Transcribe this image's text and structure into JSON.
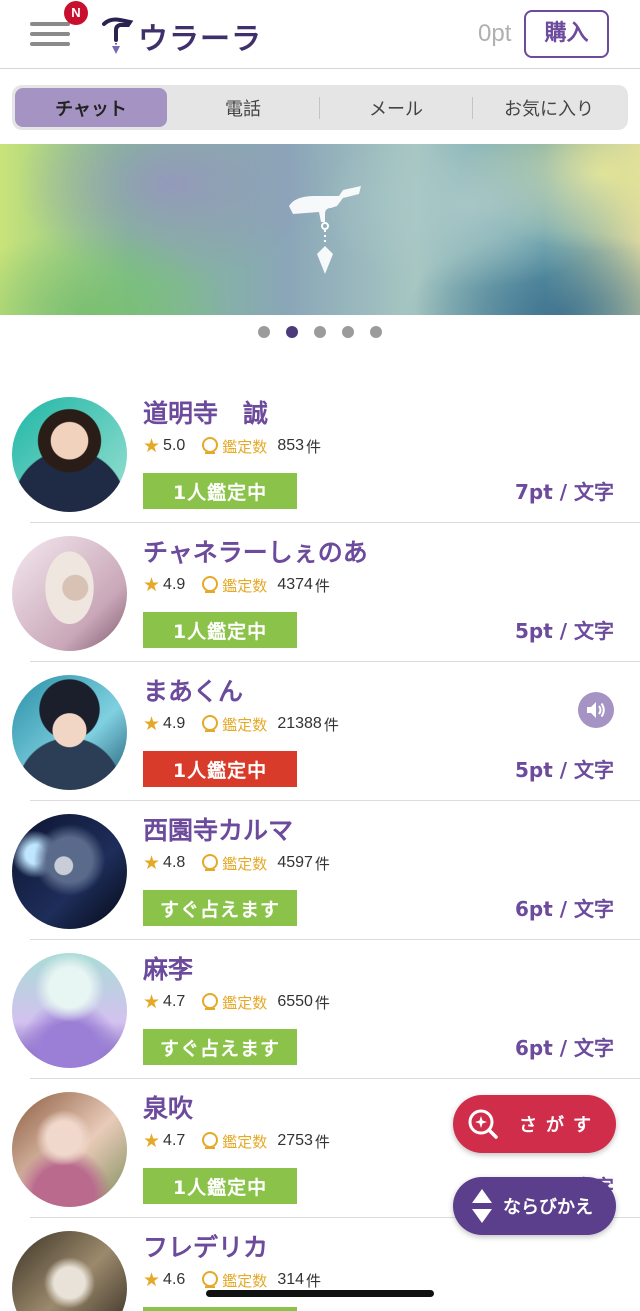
{
  "header": {
    "badge": "N",
    "logo_text": "ウラーラ",
    "points": "0pt",
    "buy_label": "購入"
  },
  "tabs": [
    {
      "label": "チャット",
      "active": true
    },
    {
      "label": "電話",
      "active": false
    },
    {
      "label": "メール",
      "active": false
    },
    {
      "label": "お気に入り",
      "active": false
    }
  ],
  "banner": {
    "slide_count": 5,
    "active_slide": 2
  },
  "count_label": "鑑定数",
  "count_unit": "件",
  "readers": [
    {
      "name": "道明寺　誠",
      "rating": "5.0",
      "count": "853",
      "status": "1人鑑定中",
      "status_color": "#8bc34a",
      "price": "7pt / 文字"
    },
    {
      "name": "チャネラーしぇのあ",
      "rating": "4.9",
      "count": "4374",
      "status": "1人鑑定中",
      "status_color": "#8bc34a",
      "price": "5pt / 文字"
    },
    {
      "name": "まあくん",
      "rating": "4.9",
      "count": "21388",
      "status": "1人鑑定中",
      "status_color": "#d93b2a",
      "price": "5pt / 文字"
    },
    {
      "name": "西園寺カルマ",
      "rating": "4.8",
      "count": "4597",
      "status": "すぐ占えます",
      "status_color": "#8bc34a",
      "price": "6pt / 文字"
    },
    {
      "name": "麻李",
      "rating": "4.7",
      "count": "6550",
      "status": "すぐ占えます",
      "status_color": "#8bc34a",
      "price": "6pt / 文字"
    },
    {
      "name": "泉吹",
      "rating": "4.7",
      "count": "2753",
      "status": "1人鑑定中",
      "status_color": "#8bc34a",
      "price": "5pt / 文字"
    },
    {
      "name": "フレデリカ",
      "rating": "4.6",
      "count": "314",
      "status": "",
      "status_color": "#8bc34a",
      "price": ""
    }
  ],
  "fab": {
    "search_label": "さがす",
    "sort_label": "ならびかえ"
  },
  "colors": {
    "brand_purple": "#6c4a9c",
    "tab_active": "#a593c4",
    "status_green": "#8bc34a",
    "status_red": "#d93b2a",
    "star": "#e5a928",
    "search_fab": "#cf2d4a",
    "sort_fab": "#5b3f8c"
  }
}
